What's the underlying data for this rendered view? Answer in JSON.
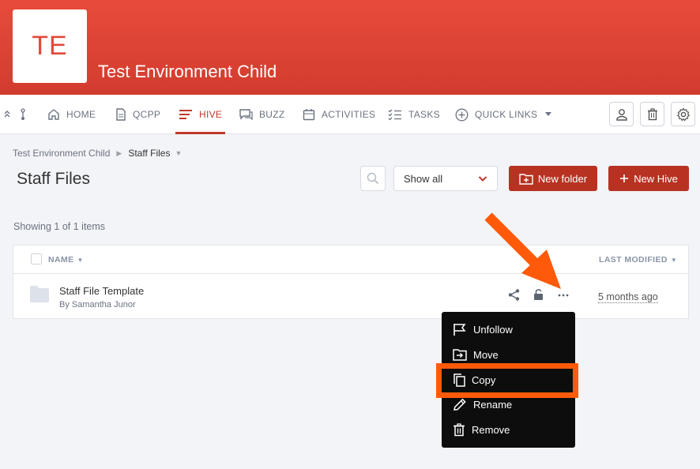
{
  "header": {
    "logo_text": "TE",
    "site_title": "Test Environment Child",
    "colors": {
      "brand": "#e04a3b",
      "accent": "#b83222"
    }
  },
  "nav": {
    "items": [
      {
        "label": "HOME",
        "icon": "home-icon"
      },
      {
        "label": "QCPP",
        "icon": "document-icon"
      },
      {
        "label": "HIVE",
        "icon": "hive-lines-icon",
        "active": true
      },
      {
        "label": "BUZZ",
        "icon": "chat-icon"
      },
      {
        "label": "ACTIVITIES",
        "icon": "calendar-icon"
      },
      {
        "label": "TASKS",
        "icon": "checklist-icon"
      },
      {
        "label": "QUICK LINKS",
        "icon": "plus-circle-icon"
      }
    ],
    "right_buttons": [
      "user-icon",
      "trash-icon",
      "gear-icon"
    ]
  },
  "breadcrumb": {
    "parent": "Test Environment Child",
    "current": "Staff Files"
  },
  "page": {
    "title": "Staff Files",
    "filter_selected": "Show all",
    "new_folder_label": "New folder",
    "new_hive_label": "New Hive",
    "showing_text": "Showing 1 of 1 items"
  },
  "table": {
    "columns": {
      "name": "NAME",
      "last_modified": "LAST MODIFIED"
    },
    "rows": [
      {
        "name": "Staff File Template",
        "by": "By Samantha Junor",
        "modified": "5 months ago"
      }
    ]
  },
  "context_menu": {
    "items": [
      {
        "label": "Unfollow",
        "icon": "flag-icon"
      },
      {
        "label": "Move",
        "icon": "move-folder-icon"
      },
      {
        "label": "Copy",
        "icon": "copy-icon",
        "highlighted": true
      },
      {
        "label": "Rename",
        "icon": "pencil-icon"
      },
      {
        "label": "Remove",
        "icon": "trash-icon"
      }
    ],
    "highlight_color": "#ff5a0a"
  }
}
